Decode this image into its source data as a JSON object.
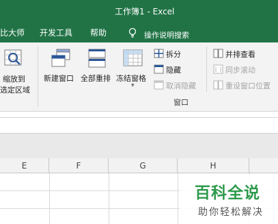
{
  "window": {
    "title": "工作簿1  -  Excel"
  },
  "ribbon_tabs": [
    {
      "label": "比大师"
    },
    {
      "label": "开发工具"
    },
    {
      "label": "帮助"
    }
  ],
  "tell_me": {
    "text": "操作说明搜索",
    "icon": "lightbulb-icon"
  },
  "ribbon": {
    "zoom_selection": {
      "line1": "缩放到",
      "line2": "选定区域",
      "icon": "zoom-to-selection-icon"
    },
    "new_window": {
      "label": "新建窗口",
      "icon": "new-window-icon"
    },
    "arrange_all": {
      "label": "全部重排",
      "icon": "arrange-all-icon"
    },
    "freeze_panes": {
      "label": "冻结窗格",
      "icon": "freeze-panes-icon",
      "dropdown": "▾"
    },
    "split": {
      "label": "拆分",
      "icon": "split-icon",
      "enabled": true
    },
    "hide": {
      "label": "隐藏",
      "icon": "hide-icon",
      "enabled": true
    },
    "unhide": {
      "label": "取消隐藏",
      "icon": "unhide-icon",
      "enabled": false
    },
    "view_side_by_side": {
      "label": "并排查看",
      "icon": "side-by-side-icon",
      "enabled": true
    },
    "sync_scroll": {
      "label": "同步滚动",
      "icon": "sync-scroll-icon",
      "enabled": false
    },
    "reset_position": {
      "label": "重设窗口位置",
      "icon": "reset-window-icon",
      "enabled": false
    },
    "group_window_label": "窗口"
  },
  "sheet": {
    "columns": [
      "E",
      "F",
      "G",
      "H"
    ]
  },
  "watermark": {
    "title": "百科全说",
    "subtitle": "助你轻松解决"
  },
  "colors": {
    "excel_green": "#217346",
    "ribbon_bg": "#f3f3f3",
    "watermark_green": "#2e9a4c",
    "icon_blue": "#2b5797"
  }
}
